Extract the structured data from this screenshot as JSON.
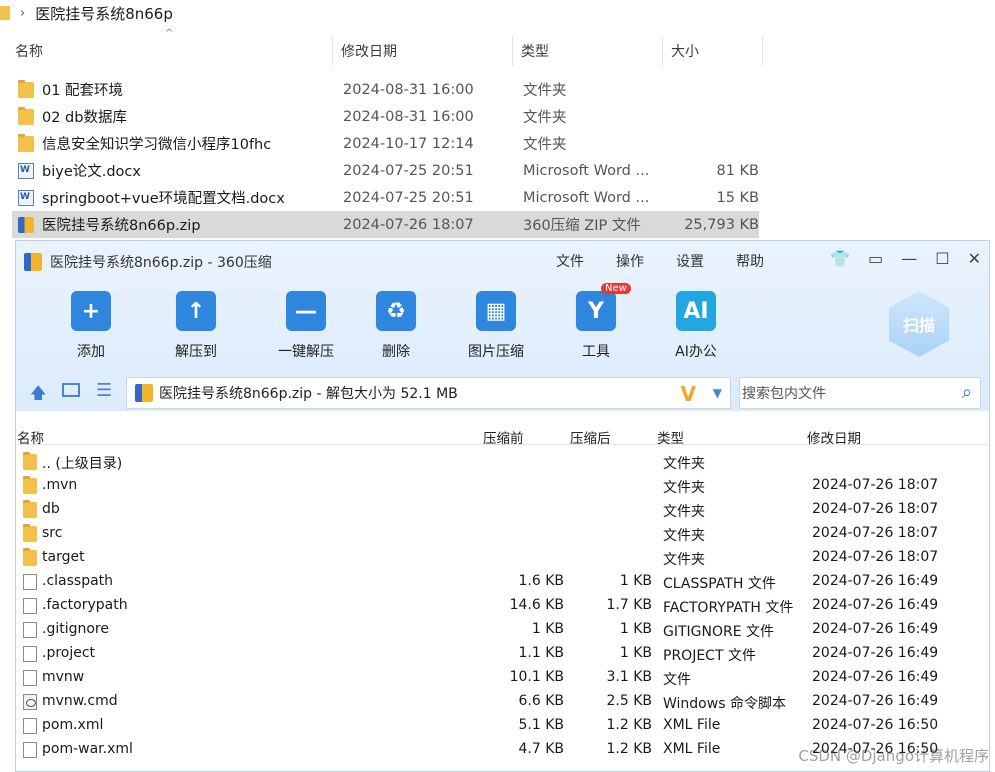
{
  "explorer": {
    "breadcrumb": "医院挂号系统8n66p",
    "columns": {
      "name": "名称",
      "modified": "修改日期",
      "type": "类型",
      "size": "大小"
    },
    "files": [
      {
        "name": "01 配套环境",
        "date": "2024-08-31 16:00",
        "type": "文件夹",
        "size": "",
        "icon": "folder-icon"
      },
      {
        "name": "02 db数据库",
        "date": "2024-08-31 16:00",
        "type": "文件夹",
        "size": "",
        "icon": "folder-icon"
      },
      {
        "name": "信息安全知识学习微信小程序10fhc",
        "date": "2024-10-17 12:14",
        "type": "文件夹",
        "size": "",
        "icon": "folder-icon"
      },
      {
        "name": "biye论文.docx",
        "date": "2024-07-25 20:51",
        "type": "Microsoft Word ...",
        "size": "81 KB",
        "icon": "word-icon"
      },
      {
        "name": "springboot+vue环境配置文档.docx",
        "date": "2024-07-25 20:51",
        "type": "Microsoft Word ...",
        "size": "15 KB",
        "icon": "word-icon"
      },
      {
        "name": "医院挂号系统8n66p.zip",
        "date": "2024-07-26 18:07",
        "type": "360压缩 ZIP 文件",
        "size": "25,793 KB",
        "icon": "zip-icon"
      }
    ]
  },
  "archiver": {
    "title": "医院挂号系统8n66p.zip - 360压缩",
    "menu": [
      "文件",
      "操作",
      "设置",
      "帮助"
    ],
    "tools": [
      {
        "label": "添加",
        "icon": "add-icon",
        "glyph": "+"
      },
      {
        "label": "解压到",
        "icon": "extract-to-icon",
        "glyph": "↑"
      },
      {
        "label": "一键解压",
        "icon": "one-click-extract-icon",
        "glyph": "—"
      },
      {
        "label": "删除",
        "icon": "delete-icon",
        "glyph": "♻"
      },
      {
        "label": "图片压缩",
        "icon": "image-compress-icon",
        "glyph": "▦"
      },
      {
        "label": "工具",
        "icon": "tools-icon",
        "glyph": "Y"
      },
      {
        "label": "AI办公",
        "icon": "ai-office-icon",
        "glyph": "AI"
      }
    ],
    "new_badge": "New",
    "scan_label": "扫描",
    "path": "医院挂号系统8n66p.zip - 解包大小为 52.1 MB",
    "search_placeholder": "搜索包内文件",
    "columns": {
      "name": "名称",
      "before": "压缩前",
      "after": "压缩后",
      "type": "类型",
      "modified": "修改日期"
    },
    "rows": [
      {
        "name": ".. (上级目录)",
        "before": "",
        "after": "",
        "type": "文件夹",
        "date": "",
        "icon": "folder-icon"
      },
      {
        "name": ".mvn",
        "before": "",
        "after": "",
        "type": "文件夹",
        "date": "2024-07-26 18:07",
        "icon": "folder-icon"
      },
      {
        "name": "db",
        "before": "",
        "after": "",
        "type": "文件夹",
        "date": "2024-07-26 18:07",
        "icon": "folder-icon"
      },
      {
        "name": "src",
        "before": "",
        "after": "",
        "type": "文件夹",
        "date": "2024-07-26 18:07",
        "icon": "folder-icon"
      },
      {
        "name": "target",
        "before": "",
        "after": "",
        "type": "文件夹",
        "date": "2024-07-26 18:07",
        "icon": "folder-icon"
      },
      {
        "name": ".classpath",
        "before": "1.6 KB",
        "after": "1 KB",
        "type": "CLASSPATH 文件",
        "date": "2024-07-26 16:49",
        "icon": "file-icon"
      },
      {
        "name": ".factorypath",
        "before": "14.6 KB",
        "after": "1.7 KB",
        "type": "FACTORYPATH 文件",
        "date": "2024-07-26 16:49",
        "icon": "file-icon"
      },
      {
        "name": ".gitignore",
        "before": "1 KB",
        "after": "1 KB",
        "type": "GITIGNORE 文件",
        "date": "2024-07-26 16:49",
        "icon": "file-icon"
      },
      {
        "name": ".project",
        "before": "1.1 KB",
        "after": "1 KB",
        "type": "PROJECT 文件",
        "date": "2024-07-26 16:49",
        "icon": "file-icon"
      },
      {
        "name": "mvnw",
        "before": "10.1 KB",
        "after": "3.1 KB",
        "type": "文件",
        "date": "2024-07-26 16:49",
        "icon": "file-icon"
      },
      {
        "name": "mvnw.cmd",
        "before": "6.6 KB",
        "after": "2.5 KB",
        "type": "Windows 命令脚本",
        "date": "2024-07-26 16:49",
        "icon": "cmd-icon"
      },
      {
        "name": "pom.xml",
        "before": "5.1 KB",
        "after": "1.2 KB",
        "type": "XML File",
        "date": "2024-07-26 16:50",
        "icon": "file-icon"
      },
      {
        "name": "pom-war.xml",
        "before": "4.7 KB",
        "after": "1.2 KB",
        "type": "XML File",
        "date": "2024-07-26 16:50",
        "icon": "file-icon"
      }
    ]
  },
  "watermark": "CSDN @Django计算机程序"
}
